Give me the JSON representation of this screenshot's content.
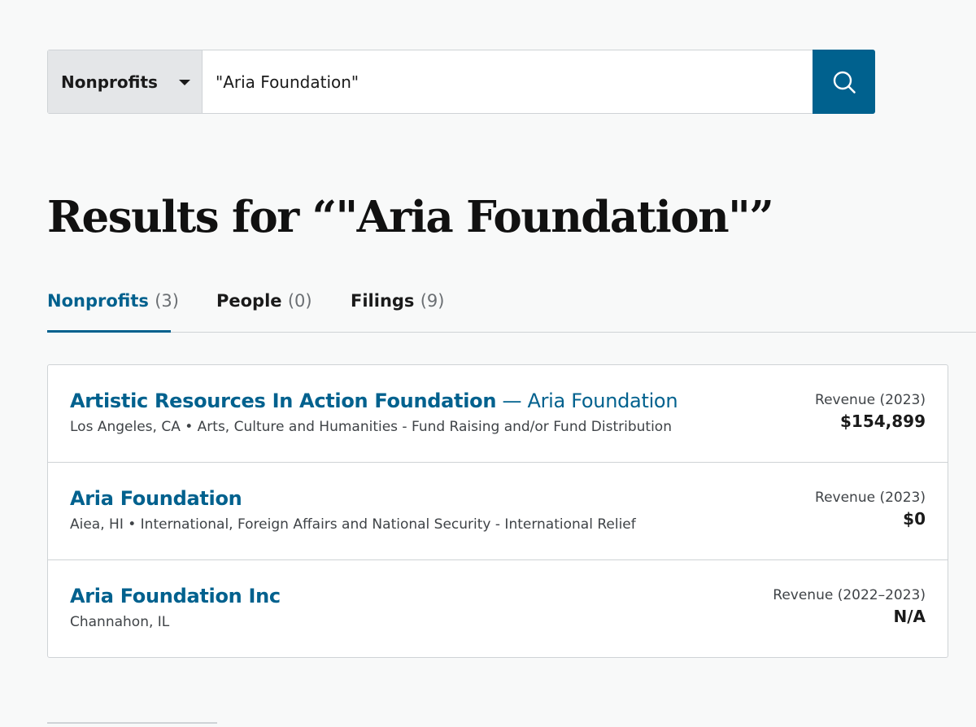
{
  "search": {
    "category": "Nonprofits",
    "query": "\"Aria Foundation\""
  },
  "heading": {
    "text": "Results for “\"Aria Foundation\"”"
  },
  "tabs": [
    {
      "label": "Nonprofits",
      "count": "(3)"
    },
    {
      "label": "People",
      "count": "(0)"
    },
    {
      "label": "Filings",
      "count": "(9)"
    }
  ],
  "results": [
    {
      "name": "Artistic Resources In Action Foundation",
      "aka": " — Aria Foundation",
      "meta": "Los Angeles, CA • Arts, Culture and Humanities - Fund Raising and/or Fund Distribution",
      "revenue_label": "Revenue (2023)",
      "revenue_value": "$154,899"
    },
    {
      "name": "Aria Foundation",
      "aka": "",
      "meta": "Aiea, HI • International, Foreign Affairs and National Security - International Relief",
      "revenue_label": "Revenue (2023)",
      "revenue_value": "$0"
    },
    {
      "name": "Aria Foundation Inc",
      "aka": "",
      "meta": "Channahon, IL",
      "revenue_label": "Revenue (2022–2023)",
      "revenue_value": "N/A"
    }
  ],
  "colors": {
    "accent": "#00618e",
    "page_background": "#f8f9f9",
    "border": "#cfd3d6"
  },
  "icons": {
    "search_button": "search-icon",
    "category_dropdown": "caret-down-icon"
  }
}
